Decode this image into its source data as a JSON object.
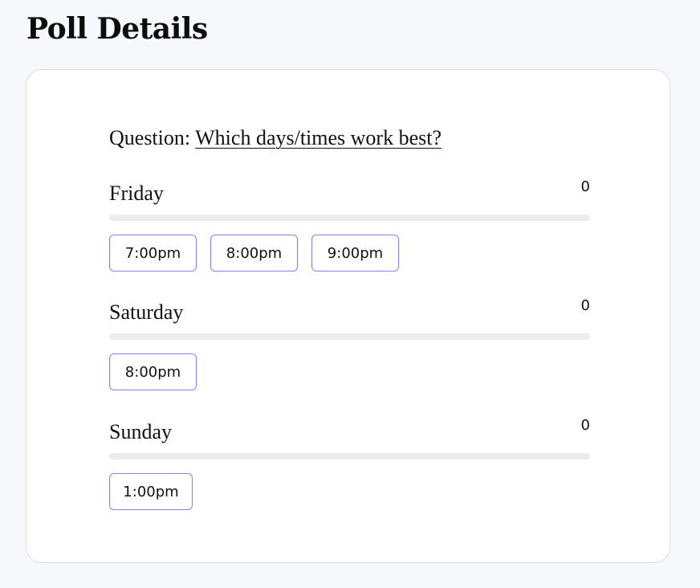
{
  "page": {
    "title": "Poll Details"
  },
  "poll": {
    "question_prefix": "Question: ",
    "question": "Which days/times work best?",
    "options": [
      {
        "day": "Friday",
        "votes": "0",
        "vote_fraction": 0,
        "times": [
          "7:00pm",
          "8:00pm",
          "9:00pm"
        ]
      },
      {
        "day": "Saturday",
        "votes": "0",
        "vote_fraction": 0,
        "times": [
          "8:00pm"
        ]
      },
      {
        "day": "Sunday",
        "votes": "0",
        "vote_fraction": 0,
        "times": [
          "1:00pm"
        ]
      }
    ]
  },
  "colors": {
    "accent": "#8b7ff0",
    "track": "#ececec",
    "background": "#f7f8fc",
    "card": "#ffffff"
  }
}
